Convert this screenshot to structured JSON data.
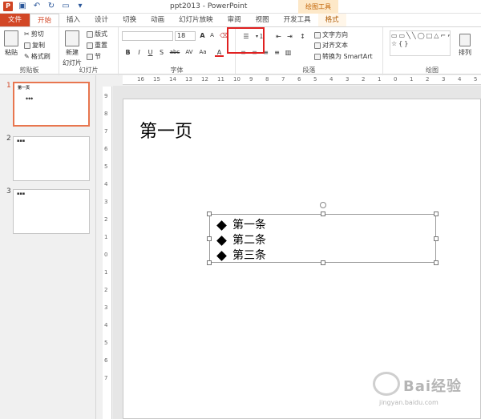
{
  "window": {
    "title": "ppt2013 - PowerPoint",
    "contextual_group": "绘图工具"
  },
  "tabs": [
    "文件",
    "开始",
    "插入",
    "设计",
    "切换",
    "动画",
    "幻灯片放映",
    "审阅",
    "视图",
    "开发工具",
    "格式"
  ],
  "ribbon": {
    "clipboard": {
      "paste": "粘贴",
      "cut": "剪切",
      "copy": "复制",
      "format_painter": "格式刷",
      "label": "剪贴板"
    },
    "slides": {
      "new_slide": "新建",
      "new_slide_2": "幻灯片",
      "layout": "版式",
      "reset": "重置",
      "section": "节",
      "label": "幻灯片"
    },
    "font": {
      "font_name": "",
      "font_size": "18",
      "bold": "B",
      "italic": "I",
      "underline": "U",
      "shadow": "S",
      "strike": "abc",
      "spacing": "AV",
      "case": "Aa",
      "color": "A",
      "grow": "A",
      "shrink": "A",
      "label": "字体"
    },
    "paragraph": {
      "text_direction": "文字方向",
      "align_text": "对齐文本",
      "smartart": "转换为 SmartArt",
      "label": "段落"
    },
    "drawing": {
      "arrange": "排列",
      "label": "绘图"
    }
  },
  "thumbnails": [
    {
      "number": "1",
      "title": "第一页",
      "body": "◆◆◆"
    },
    {
      "number": "2",
      "title": "▪▪▪",
      "body": ""
    },
    {
      "number": "3",
      "title": "▪▪▪",
      "body": ""
    }
  ],
  "ruler": {
    "top": [
      "16",
      "15",
      "14",
      "13",
      "12",
      "11",
      "10",
      "9",
      "8",
      "7",
      "6",
      "5",
      "4",
      "3",
      "2",
      "1",
      "0",
      "1",
      "2",
      "3",
      "4",
      "5"
    ],
    "left": [
      "9",
      "8",
      "7",
      "6",
      "5",
      "4",
      "3",
      "2",
      "1",
      "0",
      "1",
      "2",
      "3",
      "4",
      "5",
      "6",
      "7"
    ]
  },
  "slide": {
    "title": "第一页",
    "bullets": [
      "第一条",
      "第二条",
      "第三条"
    ]
  },
  "watermark": {
    "brand": "Bai经验",
    "url": "jingyan.baidu.com"
  },
  "colors": {
    "accent": "#d24726",
    "highlight": "#e02020"
  }
}
